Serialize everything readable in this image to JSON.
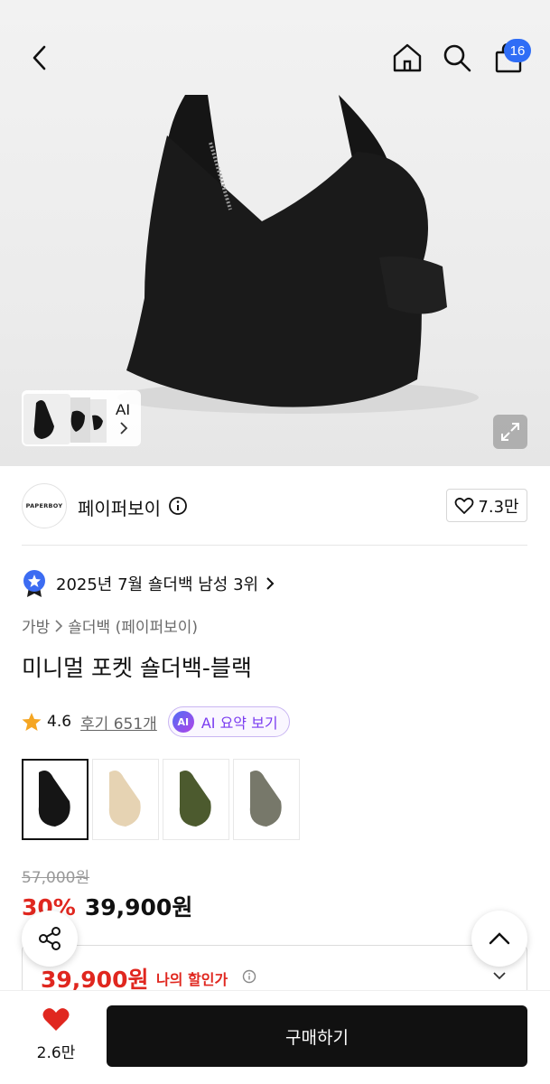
{
  "header": {
    "back_icon": "chevron-left-icon",
    "home_icon": "home-icon",
    "search_icon": "search-icon",
    "cart_icon": "shopping-bag-icon",
    "cart_count": "16"
  },
  "gallery": {
    "ai_label": "AI"
  },
  "brand": {
    "logo_text": "PAPERBOY",
    "name": "페이퍼보이",
    "likes": "7.3만"
  },
  "ranking": {
    "text": "2025년 7월 숄더백 남성 3위"
  },
  "breadcrumb": {
    "category": "가방",
    "sub": "숄더백 (페이퍼보이)"
  },
  "product": {
    "title": "미니멀 포켓 숄더백-블랙",
    "rating": "4.6",
    "reviews": "후기 651개",
    "ai_summary": "AI 요약 보기"
  },
  "colors": [
    "black",
    "beige",
    "khaki",
    "gray"
  ],
  "price": {
    "original": "57,000원",
    "discount": "30%",
    "sale": "39,900원",
    "my_price": "39,900원",
    "my_price_label": "나의 할인가"
  },
  "bottom": {
    "heart_count": "2.6만",
    "buy_label": "구매하기"
  },
  "accent": {
    "red": "#e0271f",
    "blue": "#2f6df6",
    "purple": "#7a3cf0"
  }
}
